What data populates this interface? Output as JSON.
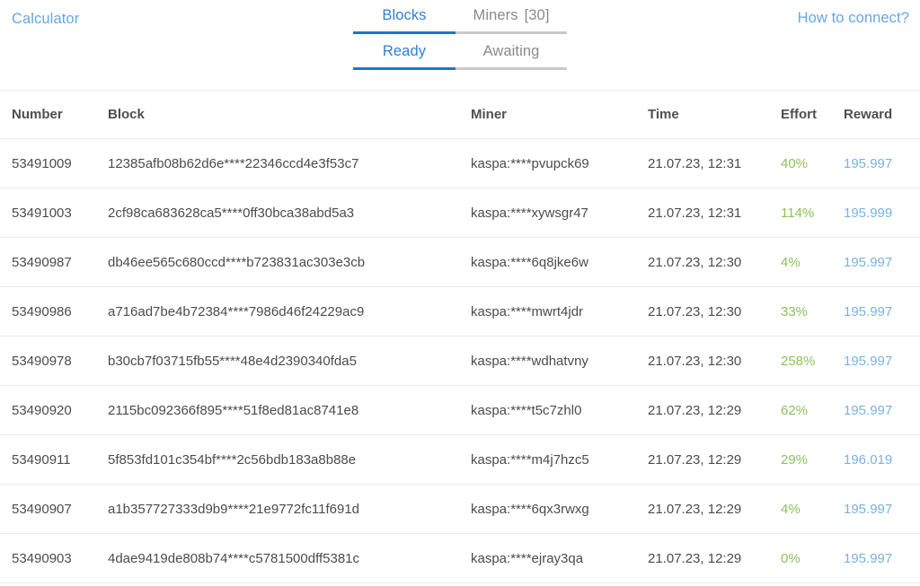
{
  "header": {
    "calculator_label": "Calculator",
    "how_to_connect_label": "How to connect?",
    "primary_tabs": [
      {
        "label": "Blocks",
        "active": true
      },
      {
        "label": "Miners",
        "count": "[30]",
        "active": false
      }
    ],
    "secondary_tabs": [
      {
        "label": "Ready",
        "active": true
      },
      {
        "label": "Awaiting",
        "active": false
      }
    ]
  },
  "colors": {
    "accent_blue": "#1976d2",
    "link_blue": "#69a5e0",
    "reward_blue": "#79b2e4",
    "effort_green": "#8dc158",
    "inactive_gray": "#8a8a8a",
    "divider": "#ececec"
  },
  "table": {
    "columns": [
      "Number",
      "Block",
      "Miner",
      "Time",
      "Effort",
      "Reward"
    ],
    "rows": [
      {
        "number": "53491009",
        "block": "12385afb08b62d6e****22346ccd4e3f53c7",
        "miner": "kaspa:****pvupck69",
        "time": "21.07.23, 12:31",
        "effort": "40%",
        "reward": "195.997"
      },
      {
        "number": "53491003",
        "block": "2cf98ca683628ca5****0ff30bca38abd5a3",
        "miner": "kaspa:****xywsgr47",
        "time": "21.07.23, 12:31",
        "effort": "114%",
        "reward": "195.999"
      },
      {
        "number": "53490987",
        "block": "db46ee565c680ccd****b723831ac303e3cb",
        "miner": "kaspa:****6q8jke6w",
        "time": "21.07.23, 12:30",
        "effort": "4%",
        "reward": "195.997"
      },
      {
        "number": "53490986",
        "block": "a716ad7be4b72384****7986d46f24229ac9",
        "miner": "kaspa:****mwrt4jdr",
        "time": "21.07.23, 12:30",
        "effort": "33%",
        "reward": "195.997"
      },
      {
        "number": "53490978",
        "block": "b30cb7f03715fb55****48e4d2390340fda5",
        "miner": "kaspa:****wdhatvny",
        "time": "21.07.23, 12:30",
        "effort": "258%",
        "reward": "195.997"
      },
      {
        "number": "53490920",
        "block": "2115bc092366f895****51f8ed81ac8741e8",
        "miner": "kaspa:****t5c7zhl0",
        "time": "21.07.23, 12:29",
        "effort": "62%",
        "reward": "195.997"
      },
      {
        "number": "53490911",
        "block": "5f853fd101c354bf****2c56bdb183a8b88e",
        "miner": "kaspa:****m4j7hzc5",
        "time": "21.07.23, 12:29",
        "effort": "29%",
        "reward": "196.019"
      },
      {
        "number": "53490907",
        "block": "a1b357727333d9b9****21e9772fc11f691d",
        "miner": "kaspa:****6qx3rwxg",
        "time": "21.07.23, 12:29",
        "effort": "4%",
        "reward": "195.997"
      },
      {
        "number": "53490903",
        "block": "4dae9419de808b74****c5781500dff5381c",
        "miner": "kaspa:****ejray3qa",
        "time": "21.07.23, 12:29",
        "effort": "0%",
        "reward": "195.997"
      }
    ]
  }
}
